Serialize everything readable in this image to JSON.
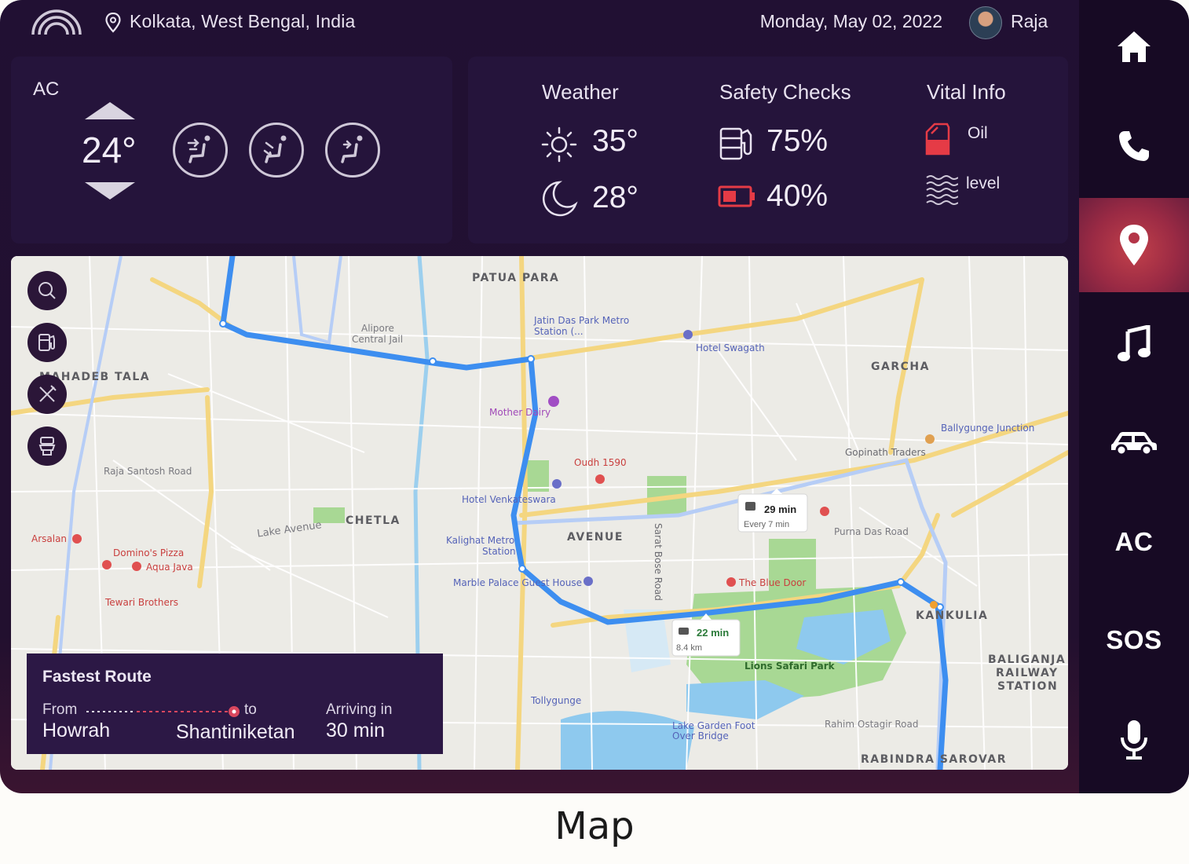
{
  "header": {
    "location": "Kolkata, West Bengal, India",
    "date": "Monday, May 02, 2022",
    "user_name": "Raja"
  },
  "ac": {
    "label": "AC",
    "temperature": "24°"
  },
  "info": {
    "weather": {
      "title": "Weather",
      "day_temp": "35°",
      "night_temp": "28°"
    },
    "safety": {
      "title": "Safety Checks",
      "fuel": "75%",
      "battery": "40%",
      "battery_color": "#e53b46"
    },
    "vital": {
      "title": "Vital Info",
      "line1": "Oil",
      "line2": "level",
      "oil_color": "#e53b46"
    }
  },
  "sidebar": {
    "items": [
      {
        "icon": "home-icon"
      },
      {
        "icon": "phone-icon"
      },
      {
        "icon": "map-pin-icon",
        "active": true
      },
      {
        "icon": "music-icon"
      },
      {
        "icon": "car-icon"
      },
      {
        "label": "AC"
      },
      {
        "label": "SOS"
      },
      {
        "icon": "microphone-icon"
      }
    ],
    "active_color": "#c2404a"
  },
  "map": {
    "labels": {
      "patua_para": "PATUA PARA",
      "garcha": "GARCHA",
      "chetla": "CHETLA",
      "avenue": "AVENUE",
      "mahadeb_tala": "MAHADEB TALA",
      "kasba_kulia": "KANKULIA",
      "baliganj": "BALIGANJA",
      "railway": "RAILWAY",
      "station": "STATION",
      "rabindra": "RABINDRA SAROVAR",
      "alipore_jail": "Alipore",
      "alipore_jail2": "Central Jail",
      "jatin": "Jatin Das Park Metro",
      "jatin2": "Station (...",
      "hotel_swagath": "Hotel Swagath",
      "mother_dairy": "Mother Dairy",
      "oudh": "Oudh 1590",
      "hotel_venk": "Hotel Venkateswara",
      "kalighat": "Kalighat Metro",
      "kalighat2": "Station",
      "marble": "Marble Palace Guest House",
      "blue_door": "The Blue Door",
      "lions": "Lions Safari Park",
      "dominos": "Domino's Pizza",
      "aqua": "Aqua Java",
      "tewari": "Tewari Brothers",
      "arsalan": "Arsalan",
      "gopinath": "Gopinath Traders",
      "ballygunge_jn": "Ballygunge Junction",
      "lake_avenue": "Lake Avenue",
      "tollygunge": "Tollygunge",
      "lake_garden": "Lake Garden Foot",
      "lake_garden2": "Over Bridge",
      "purna": "Purna Das Road",
      "raja_santosh": "Raja Santosh Road",
      "sarat_bose": "Sarat Bose Road",
      "rahim": "Rahim Ostagir Road"
    },
    "route_box_1": {
      "time": "22 min",
      "distance": "8.4 km"
    },
    "route_box_2": {
      "time": "29 min",
      "sub": "Every 7 min"
    },
    "route_color": "#3d8ef0",
    "park_color": "#9ed28b",
    "water_color": "#8ec9ee",
    "road_color": "#f6dc8a"
  },
  "route_card": {
    "title": "Fastest Route",
    "from_label": "From",
    "from_value": "Howrah",
    "to_label": "to",
    "to_value": "Shantiniketan",
    "arriving_label": "Arriving in",
    "arriving_value": "30 min"
  },
  "caption": "Map"
}
